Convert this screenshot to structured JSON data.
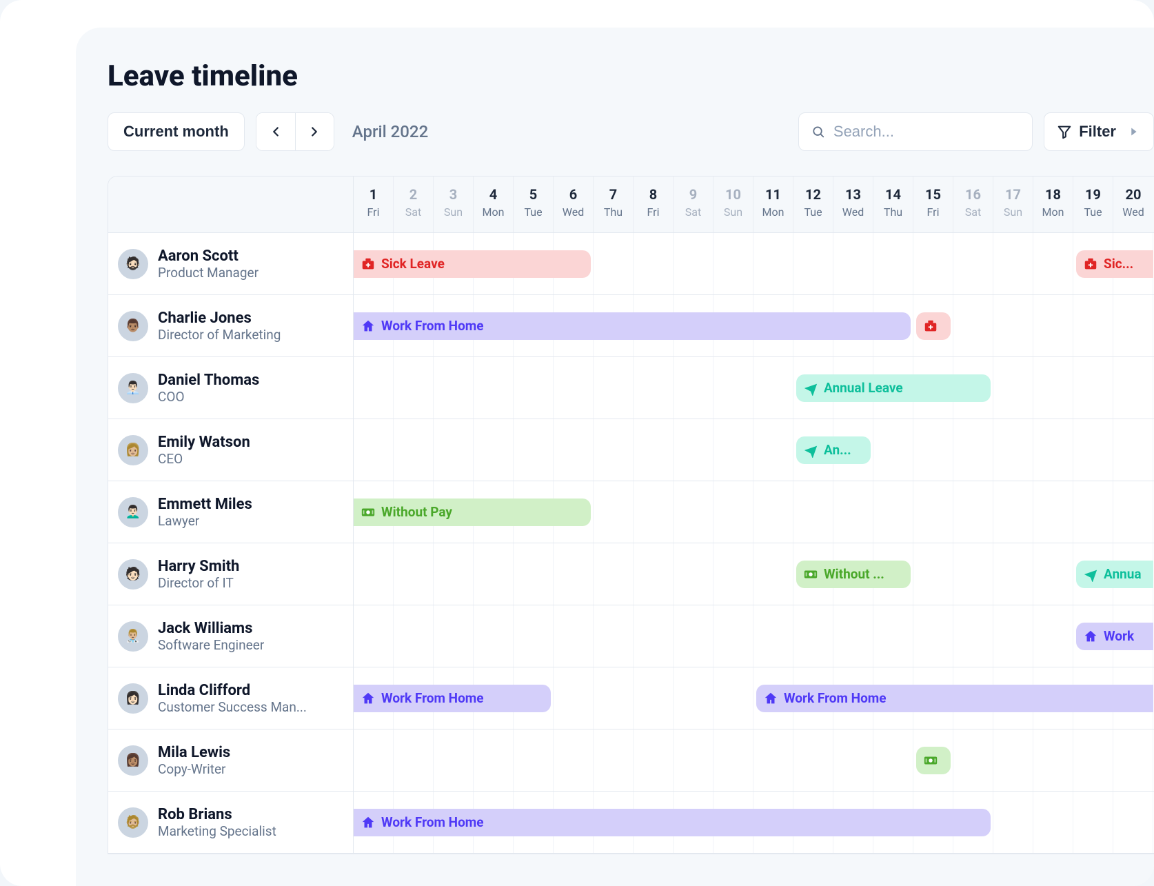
{
  "title": "Leave timeline",
  "toolbar": {
    "current_month_label": "Current month",
    "month_label": "April 2022",
    "search_placeholder": "Search...",
    "filter_label": "Filter"
  },
  "days": [
    {
      "num": "1",
      "dow": "Fri",
      "weekend": false
    },
    {
      "num": "2",
      "dow": "Sat",
      "weekend": true
    },
    {
      "num": "3",
      "dow": "Sun",
      "weekend": true
    },
    {
      "num": "4",
      "dow": "Mon",
      "weekend": false
    },
    {
      "num": "5",
      "dow": "Tue",
      "weekend": false
    },
    {
      "num": "6",
      "dow": "Wed",
      "weekend": false
    },
    {
      "num": "7",
      "dow": "Thu",
      "weekend": false
    },
    {
      "num": "8",
      "dow": "Fri",
      "weekend": false
    },
    {
      "num": "9",
      "dow": "Sat",
      "weekend": true
    },
    {
      "num": "10",
      "dow": "Sun",
      "weekend": true
    },
    {
      "num": "11",
      "dow": "Mon",
      "weekend": false
    },
    {
      "num": "12",
      "dow": "Tue",
      "weekend": false
    },
    {
      "num": "13",
      "dow": "Wed",
      "weekend": false
    },
    {
      "num": "14",
      "dow": "Thu",
      "weekend": false
    },
    {
      "num": "15",
      "dow": "Fri",
      "weekend": false
    },
    {
      "num": "16",
      "dow": "Sat",
      "weekend": true
    },
    {
      "num": "17",
      "dow": "Sun",
      "weekend": true
    },
    {
      "num": "18",
      "dow": "Mon",
      "weekend": false
    },
    {
      "num": "19",
      "dow": "Tue",
      "weekend": false
    },
    {
      "num": "20",
      "dow": "Wed",
      "weekend": false
    }
  ],
  "leave_types": {
    "sick": {
      "label": "Sick Leave",
      "icon": "medkit",
      "color_bg": "#fbd5d5",
      "color_text": "#e02424"
    },
    "wfh": {
      "label": "Work From Home",
      "icon": "home",
      "color_bg": "#d4cffa",
      "color_text": "#4f39f6"
    },
    "annual": {
      "label": "Annual Leave",
      "icon": "plane",
      "color_bg": "#c4f6e8",
      "color_text": "#0dbf9b"
    },
    "withoutpay": {
      "label": "Without Pay",
      "icon": "money",
      "color_bg": "#d1f0c7",
      "color_text": "#4aa82a"
    }
  },
  "employees": [
    {
      "name": "Aaron Scott",
      "role": "Product Manager",
      "avatar_emoji": "🧔🏻",
      "bars": [
        {
          "type": "sick",
          "start": 1,
          "end": 6,
          "display": "Sick Leave",
          "cut_start": true
        },
        {
          "type": "sick",
          "start": 19,
          "end": 20,
          "display": "Sic...",
          "cut_end": true
        }
      ]
    },
    {
      "name": "Charlie Jones",
      "role": "Director of Marketing",
      "avatar_emoji": "👨🏽",
      "bars": [
        {
          "type": "wfh",
          "start": 1,
          "end": 14,
          "display": "Work From Home",
          "cut_start": true
        },
        {
          "type": "sick",
          "start": 15,
          "end": 15,
          "display": "",
          "icon_only": true
        }
      ]
    },
    {
      "name": "Daniel Thomas",
      "role": "COO",
      "avatar_emoji": "👨🏻‍💼",
      "bars": [
        {
          "type": "annual",
          "start": 12,
          "end": 16,
          "display": "Annual Leave"
        }
      ]
    },
    {
      "name": "Emily Watson",
      "role": "CEO",
      "avatar_emoji": "👩🏼",
      "bars": [
        {
          "type": "annual",
          "start": 12,
          "end": 13,
          "display": "An..."
        }
      ]
    },
    {
      "name": "Emmett Miles",
      "role": "Lawyer",
      "avatar_emoji": "👨🏻‍🦱",
      "bars": [
        {
          "type": "withoutpay",
          "start": 1,
          "end": 6,
          "display": "Without Pay",
          "cut_start": true
        }
      ]
    },
    {
      "name": "Harry Smith",
      "role": "Director of IT",
      "avatar_emoji": "🧑🏻",
      "bars": [
        {
          "type": "withoutpay",
          "start": 12,
          "end": 14,
          "display": "Without ..."
        },
        {
          "type": "annual",
          "start": 19,
          "end": 20,
          "display": "Annua",
          "cut_end": true
        }
      ]
    },
    {
      "name": "Jack Williams",
      "role": "Software Engineer",
      "avatar_emoji": "👨🏼‍⚕️",
      "bars": [
        {
          "type": "wfh",
          "start": 19,
          "end": 20,
          "display": "Work",
          "cut_end": true
        }
      ]
    },
    {
      "name": "Linda Clifford",
      "role": "Customer Success Man...",
      "avatar_emoji": "👩🏻",
      "bars": [
        {
          "type": "wfh",
          "start": 1,
          "end": 5,
          "display": "Work From Home",
          "cut_start": true
        },
        {
          "type": "wfh",
          "start": 11,
          "end": 20,
          "display": "Work From Home",
          "cut_end": true
        }
      ]
    },
    {
      "name": "Mila Lewis",
      "role": "Copy-Writer",
      "avatar_emoji": "👩🏽",
      "bars": [
        {
          "type": "withoutpay",
          "start": 15,
          "end": 15,
          "display": "",
          "icon_only": true
        }
      ]
    },
    {
      "name": "Rob Brians",
      "role": "Marketing Specialist",
      "avatar_emoji": "🧔🏼",
      "bars": [
        {
          "type": "wfh",
          "start": 1,
          "end": 16,
          "display": "Work From Home",
          "cut_start": true
        }
      ]
    }
  ]
}
